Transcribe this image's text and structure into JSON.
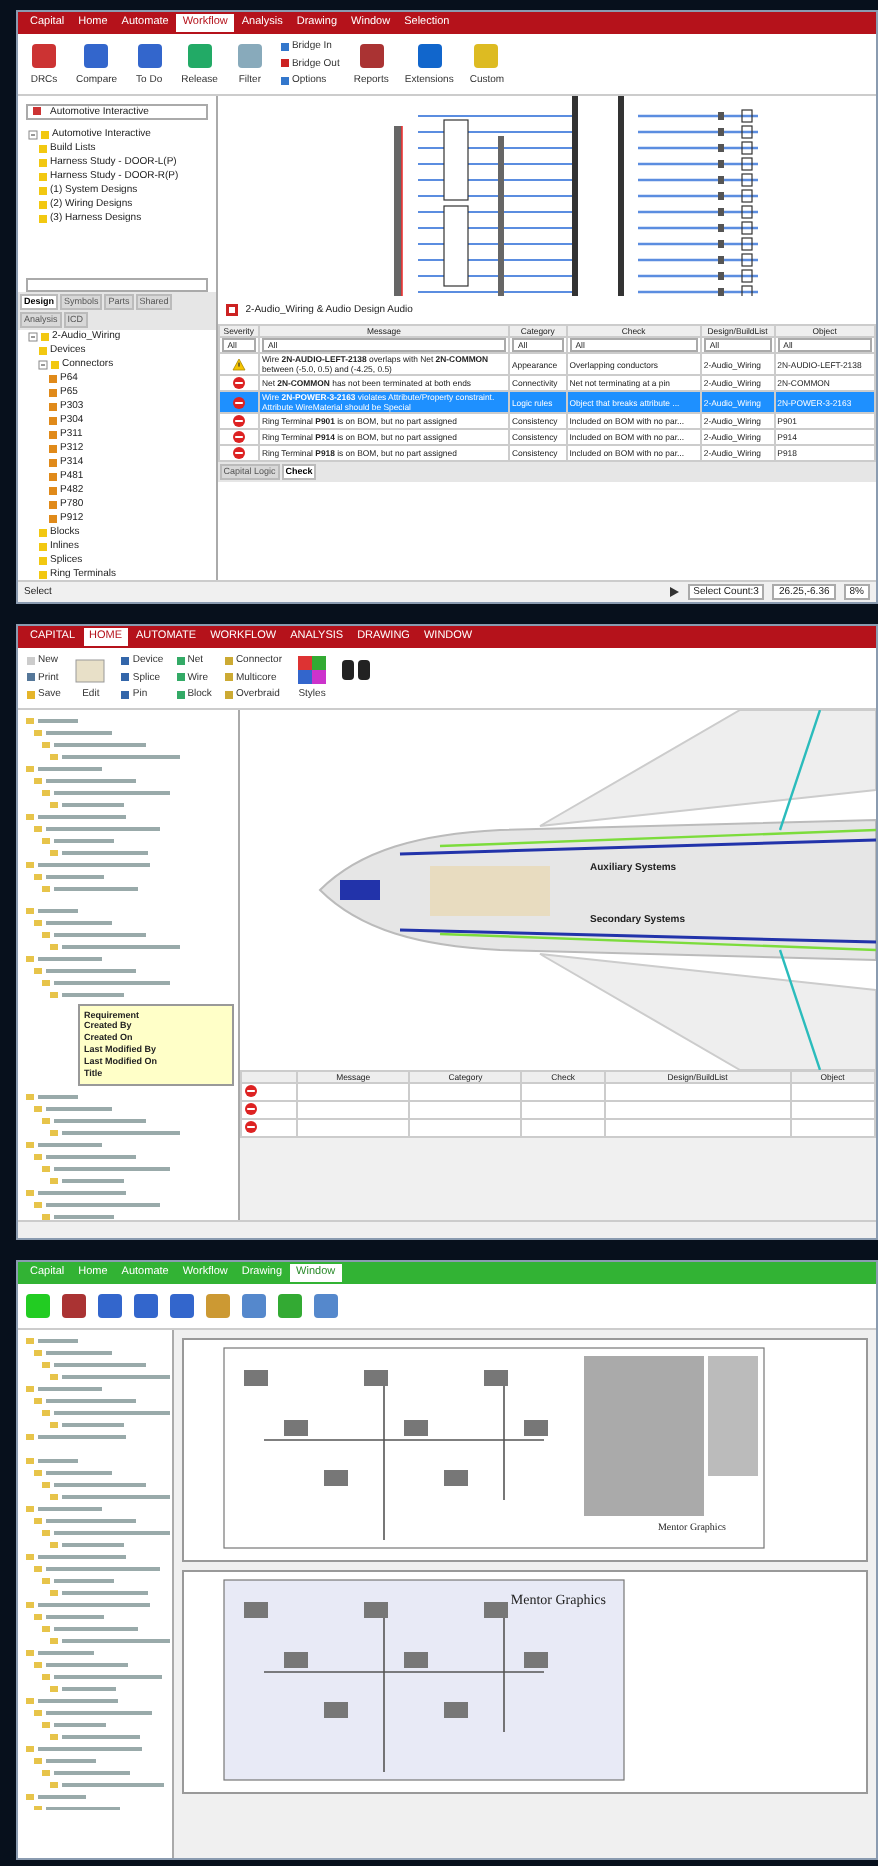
{
  "logic_window": {
    "menu": [
      {
        "label": "Capital",
        "selected": false
      },
      {
        "label": "Home",
        "selected": false
      },
      {
        "label": "Automate",
        "selected": false
      },
      {
        "label": "Workflow",
        "selected": true
      },
      {
        "label": "Analysis",
        "selected": false
      },
      {
        "label": "Drawing",
        "selected": false
      },
      {
        "label": "Window",
        "selected": false
      },
      {
        "label": "Selection",
        "selected": false
      }
    ],
    "ribbon": [
      {
        "label": "DRCs",
        "kind": "large"
      },
      {
        "label": "Compare",
        "kind": "large"
      },
      {
        "label": "To Do",
        "kind": "large"
      },
      {
        "label": "Release",
        "kind": "large"
      },
      {
        "label": "Filter",
        "kind": "large"
      },
      {
        "label": "Bridge In",
        "kind": "small"
      },
      {
        "label": "Bridge Out",
        "kind": "small"
      },
      {
        "label": "Options",
        "kind": "small"
      },
      {
        "label": "Reports",
        "kind": "large"
      },
      {
        "label": "Extensions",
        "kind": "large"
      },
      {
        "label": "Custom",
        "kind": "large"
      }
    ],
    "project": "Automotive Interactive",
    "project_tree": [
      {
        "label": "Automotive Interactive",
        "expanded": true,
        "children": [
          {
            "label": "Build Lists"
          },
          {
            "label": "Harness Study - DOOR-L(P)"
          },
          {
            "label": "Harness Study - DOOR-R(P)"
          },
          {
            "label": "(1) System Designs"
          },
          {
            "label": "(2) Wiring Designs"
          },
          {
            "label": "(3) Harness Designs"
          }
        ]
      }
    ],
    "side_tabs": [
      {
        "label": "Design",
        "selected": true
      },
      {
        "label": "Symbols",
        "selected": false
      },
      {
        "label": "Parts",
        "selected": false
      },
      {
        "label": "Shared",
        "selected": false
      },
      {
        "label": "Analysis",
        "selected": false
      },
      {
        "label": "ICD",
        "selected": false
      }
    ],
    "design_tree": [
      {
        "label": "2-Audio_Wiring",
        "expanded": true,
        "children": [
          {
            "label": "Devices"
          },
          {
            "label": "Connectors",
            "expanded": true,
            "children": [
              {
                "label": "P64"
              },
              {
                "label": "P65"
              },
              {
                "label": "P303"
              },
              {
                "label": "P304"
              },
              {
                "label": "P311"
              },
              {
                "label": "P312"
              },
              {
                "label": "P314"
              },
              {
                "label": "P481"
              },
              {
                "label": "P482"
              },
              {
                "label": "P780"
              },
              {
                "label": "P912"
              }
            ]
          },
          {
            "label": "Blocks"
          },
          {
            "label": "Inlines"
          },
          {
            "label": "Splices"
          },
          {
            "label": "Ring Terminals"
          }
        ]
      }
    ],
    "check_title": "2-Audio_Wiring & Audio Design Audio",
    "columns": [
      "Severity",
      "Message",
      "Category",
      "Check",
      "Design/BuildList",
      "Object"
    ],
    "filters": [
      "All",
      "All",
      "All",
      "All",
      "All",
      "All"
    ],
    "rows": [
      {
        "kind": "warning",
        "selected": false,
        "message": "Wire **2N-AUDIO-LEFT-2138** overlaps with Net **2N-COMMON** between (-5.0, 0.5) and (-4.25, 0.5)",
        "category": "Appearance",
        "check": "Overlapping conductors",
        "design": "2-Audio_Wiring",
        "object": "2N-AUDIO-LEFT-2138"
      },
      {
        "kind": "error",
        "selected": false,
        "message": "Net **2N-COMMON** has not been terminated at both ends",
        "category": "Connectivity",
        "check": "Net not terminating at a pin",
        "design": "2-Audio_Wiring",
        "object": "2N-COMMON"
      },
      {
        "kind": "error",
        "selected": true,
        "message": "Wire **2N-POWER-3-2163** violates Attribute/Property constraint. Attribute WireMaterial should be Special",
        "category": "Logic rules",
        "check": "Object that breaks attribute ...",
        "design": "2-Audio_Wiring",
        "object": "2N-POWER-3-2163"
      },
      {
        "kind": "error",
        "selected": false,
        "message": "Ring Terminal **P901** is on BOM, but no part assigned",
        "category": "Consistency",
        "check": "Included on BOM with no par...",
        "design": "2-Audio_Wiring",
        "object": "P901"
      },
      {
        "kind": "error",
        "selected": false,
        "message": "Ring Terminal **P914** is on BOM, but no part assigned",
        "category": "Consistency",
        "check": "Included on BOM with no par...",
        "design": "2-Audio_Wiring",
        "object": "P914"
      },
      {
        "kind": "error",
        "selected": false,
        "message": "Ring Terminal **P918** is on BOM, but no part assigned",
        "category": "Consistency",
        "check": "Included on BOM with no par...",
        "design": "2-Audio_Wiring",
        "object": "P918"
      }
    ],
    "bottom_tabs": [
      {
        "label": "Capital Logic",
        "selected": false
      },
      {
        "label": "Check",
        "selected": true
      }
    ],
    "status": {
      "mode": "Select",
      "count": "Select Count:3",
      "coords": "26.25,-6.36",
      "zoom": "8%"
    }
  },
  "aircraft_window": {
    "menu": [
      {
        "label": "CAPITAL",
        "selected": false
      },
      {
        "label": "HOME",
        "selected": true
      },
      {
        "label": "AUTOMATE",
        "selected": false
      },
      {
        "label": "WORKFLOW",
        "selected": false
      },
      {
        "label": "ANALYSIS",
        "selected": false
      },
      {
        "label": "DRAWING",
        "selected": false
      },
      {
        "label": "WINDOW",
        "selected": false
      }
    ],
    "file_buttons": [
      "New",
      "Print",
      "Save"
    ],
    "edit_label": "Edit",
    "insert_buttons": [
      "Device",
      "Net",
      "Connector",
      "Splice",
      "Wire",
      "Multicore",
      "Pin",
      "Block",
      "Overbraid"
    ],
    "styles_label": "Styles",
    "diagram_labels": [
      "Auxiliary Systems",
      "Secondary Systems"
    ],
    "tooltip": [
      "Requirement",
      "Created By",
      "Created On",
      "Last Modified By",
      "Last Modified On",
      "Title"
    ],
    "columns": [
      "Message",
      "Category",
      "Check",
      "Design/BuildList",
      "Object"
    ]
  },
  "harness_window": {
    "menu": [
      {
        "label": "Capital",
        "selected": false
      },
      {
        "label": "Home",
        "selected": false
      },
      {
        "label": "Automate",
        "selected": false
      },
      {
        "label": "Workflow",
        "selected": false
      },
      {
        "label": "Drawing",
        "selected": false
      },
      {
        "label": "Window",
        "selected": true
      }
    ],
    "title_block": "Mentor Graphics",
    "sheet_title": "Mentor Graphics"
  }
}
